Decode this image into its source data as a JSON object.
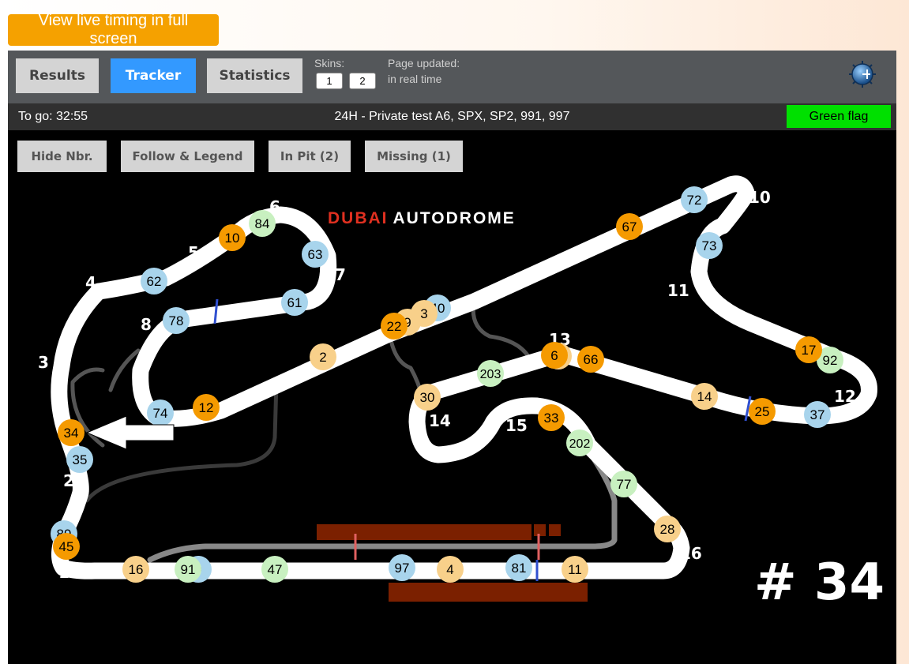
{
  "fullscreen_button": "View live timing in full screen",
  "tabs": {
    "results": "Results",
    "tracker": "Tracker",
    "statistics": "Statistics"
  },
  "skins": {
    "label": "Skins:",
    "options": [
      "1",
      "2"
    ]
  },
  "page_updated": {
    "label": "Page updated:",
    "value": "in real time"
  },
  "settings_icon": "settings-dial-icon",
  "info": {
    "to_go": "To go: 32:55",
    "session": "24H - Private test A6, SPX, SP2, 991, 997",
    "flag": "Green flag",
    "flag_color": "#00e000"
  },
  "tracker_buttons": {
    "hide_numbers": "Hide Nbr.",
    "follow_legend": "Follow & Legend",
    "in_pit": "In Pit (2)",
    "missing": "Missing (1)"
  },
  "track": {
    "logo_part1": "DUBAI",
    "logo_part2": "AUTODROME",
    "logo_color1": "#e03020",
    "logo_color2": "#ffffff",
    "turns": [
      "1",
      "2",
      "3",
      "4",
      "5",
      "6",
      "7",
      "8",
      "10",
      "11",
      "12",
      "13",
      "14",
      "15",
      "16"
    ],
    "selected_car": "# 34",
    "class_colors": {
      "orange": "#f59a00",
      "peach": "#f8d08a",
      "blue": "#a8d4ec",
      "green": "#c8f0c0"
    },
    "cars": [
      {
        "num": "34",
        "color": "orange"
      },
      {
        "num": "35",
        "color": "blue"
      },
      {
        "num": "89",
        "color": "blue"
      },
      {
        "num": "45",
        "color": "orange"
      },
      {
        "num": "16",
        "color": "peach"
      },
      {
        "num": "9",
        "color": "blue"
      },
      {
        "num": "91",
        "color": "green"
      },
      {
        "num": "47",
        "color": "green"
      },
      {
        "num": "97",
        "color": "blue"
      },
      {
        "num": "4",
        "color": "peach"
      },
      {
        "num": "81",
        "color": "blue"
      },
      {
        "num": "11",
        "color": "peach"
      },
      {
        "num": "28",
        "color": "peach"
      },
      {
        "num": "77",
        "color": "green"
      },
      {
        "num": "202",
        "color": "green"
      },
      {
        "num": "33",
        "color": "orange"
      },
      {
        "num": "30",
        "color": "peach"
      },
      {
        "num": "203",
        "color": "green"
      },
      {
        "num": "6",
        "color": "peach"
      },
      {
        "num": "6",
        "color": "orange"
      },
      {
        "num": "66",
        "color": "orange"
      },
      {
        "num": "14",
        "color": "peach"
      },
      {
        "num": "25",
        "color": "orange"
      },
      {
        "num": "37",
        "color": "blue"
      },
      {
        "num": "92",
        "color": "green"
      },
      {
        "num": "17",
        "color": "orange"
      },
      {
        "num": "73",
        "color": "blue"
      },
      {
        "num": "72",
        "color": "blue"
      },
      {
        "num": "67",
        "color": "orange"
      },
      {
        "num": "40",
        "color": "blue"
      },
      {
        "num": "3",
        "color": "peach"
      },
      {
        "num": "9",
        "color": "peach"
      },
      {
        "num": "22",
        "color": "orange"
      },
      {
        "num": "2",
        "color": "peach"
      },
      {
        "num": "12",
        "color": "orange"
      },
      {
        "num": "74",
        "color": "blue"
      },
      {
        "num": "78",
        "color": "blue"
      },
      {
        "num": "62",
        "color": "blue"
      },
      {
        "num": "10",
        "color": "orange"
      },
      {
        "num": "84",
        "color": "green"
      },
      {
        "num": "63",
        "color": "blue"
      },
      {
        "num": "61",
        "color": "blue"
      }
    ]
  }
}
